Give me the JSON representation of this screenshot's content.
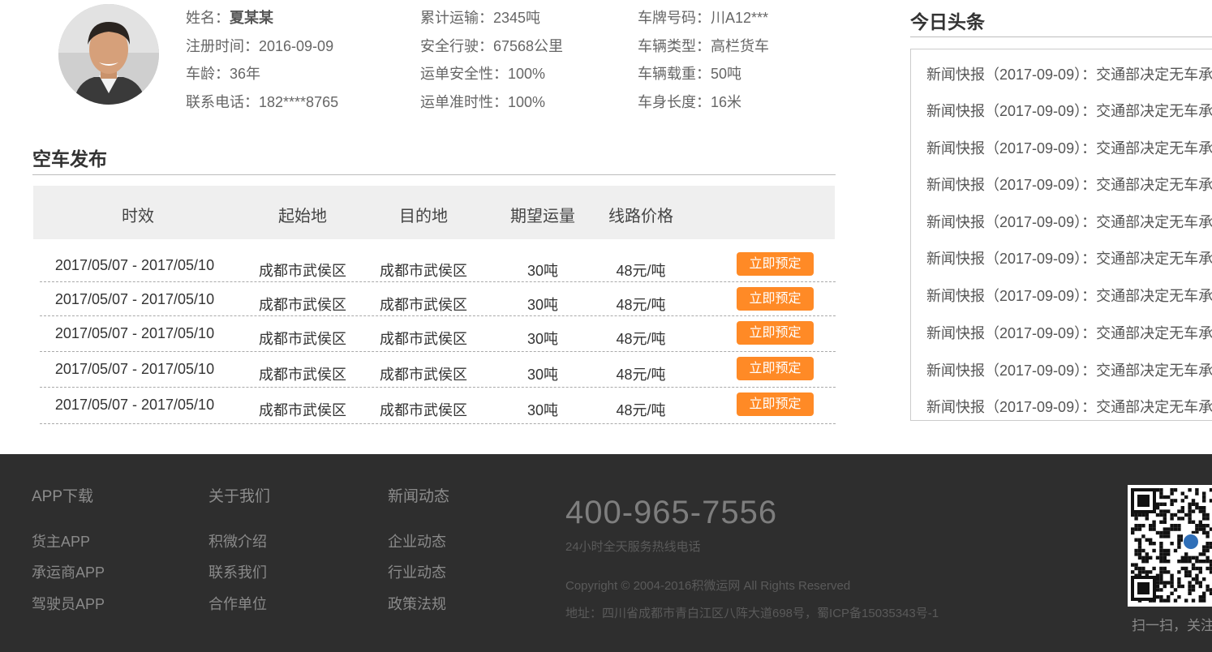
{
  "profile": {
    "col1": [
      {
        "label": "姓名：",
        "value": "夏某某"
      },
      {
        "label": "注册时间：",
        "value": "2016-09-09"
      },
      {
        "label": "车龄：",
        "value": "36年"
      },
      {
        "label": "联系电话：",
        "value": "182****8765"
      }
    ],
    "col2": [
      {
        "label": "累计运输：",
        "value": "2345吨"
      },
      {
        "label": "安全行驶：",
        "value": "67568公里"
      },
      {
        "label": "运单安全性：",
        "value": "100%"
      },
      {
        "label": "运单准时性：",
        "value": "100%"
      }
    ],
    "col3": [
      {
        "label": "车牌号码：",
        "value": "川A12***"
      },
      {
        "label": "车辆类型：",
        "value": "高栏货车"
      },
      {
        "label": "车辆载重：",
        "value": "50吨"
      },
      {
        "label": "车身长度：",
        "value": "16米"
      }
    ]
  },
  "empty_trucks": {
    "title": "空车发布",
    "headers": [
      "时效",
      "起始地",
      "目的地",
      "期望运量",
      "线路价格"
    ],
    "rows": [
      {
        "period": "2017/05/07 - 2017/05/10",
        "origin": "成都市武侯区",
        "destination": "成都市武侯区",
        "volume": "30吨",
        "price": "48元/吨",
        "action": "立即预定"
      },
      {
        "period": "2017/05/07 - 2017/05/10",
        "origin": "成都市武侯区",
        "destination": "成都市武侯区",
        "volume": "30吨",
        "price": "48元/吨",
        "action": "立即预定"
      },
      {
        "period": "2017/05/07 - 2017/05/10",
        "origin": "成都市武侯区",
        "destination": "成都市武侯区",
        "volume": "30吨",
        "price": "48元/吨",
        "action": "立即预定"
      },
      {
        "period": "2017/05/07 - 2017/05/10",
        "origin": "成都市武侯区",
        "destination": "成都市武侯区",
        "volume": "30吨",
        "price": "48元/吨",
        "action": "立即预定"
      },
      {
        "period": "2017/05/07 - 2017/05/10",
        "origin": "成都市武侯区",
        "destination": "成都市武侯区",
        "volume": "30吨",
        "price": "48元/吨",
        "action": "立即预定"
      }
    ]
  },
  "news": {
    "title": "今日头条",
    "items": [
      "新闻快报（2017-09-09）：交通部决定无车承",
      "新闻快报（2017-09-09）：交通部决定无车承",
      "新闻快报（2017-09-09）：交通部决定无车承",
      "新闻快报（2017-09-09）：交通部决定无车承",
      "新闻快报（2017-09-09）：交通部决定无车承",
      "新闻快报（2017-09-09）：交通部决定无车承",
      "新闻快报（2017-09-09）：交通部决定无车承",
      "新闻快报（2017-09-09）：交通部决定无车承",
      "新闻快报（2017-09-09）：交通部决定无车承",
      "新闻快报（2017-09-09）：交通部决定无车承"
    ]
  },
  "footer": {
    "columns": [
      {
        "heading": "APP下载",
        "links": [
          "货主APP",
          "承运商APP",
          "驾驶员APP"
        ]
      },
      {
        "heading": "关于我们",
        "links": [
          "积微介绍",
          "联系我们",
          "合作单位"
        ]
      },
      {
        "heading": "新闻动态",
        "links": [
          "企业动态",
          "行业动态",
          "政策法规"
        ]
      }
    ],
    "phone": "400-965-7556",
    "phone_caption": "24小时全天服务热线电话",
    "copyright": "Copyright © 2004-2016积微运网 All Rights Reserved",
    "address": "地址：四川省成都市青白江区八阵大道698号，蜀ICP备15035343号-1",
    "qr_caption": "扫一扫，关注"
  },
  "colors": {
    "accent": "#ff8a26",
    "footer_bg": "#2e2e2e",
    "table_header_bg": "#efefef"
  }
}
